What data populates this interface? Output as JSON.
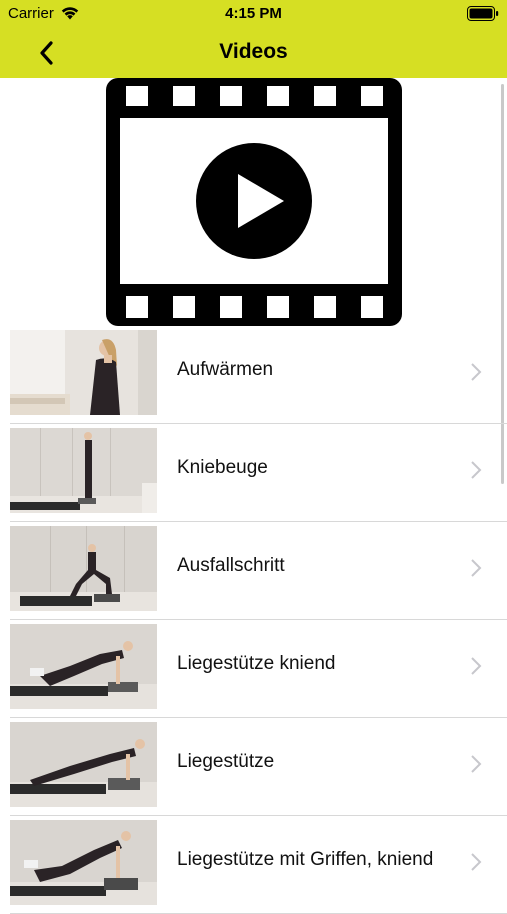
{
  "status": {
    "carrier": "Carrier",
    "time": "4:15 PM"
  },
  "nav": {
    "title": "Videos",
    "back_icon": "chevron-left-icon"
  },
  "colors": {
    "header_bg": "#d6df23",
    "separator": "#d8d8d8",
    "chevron": "#c7c7cc"
  },
  "items": [
    {
      "label": "Aufwärmen",
      "thumb_pose": "standing-side"
    },
    {
      "label": "Kniebeuge",
      "thumb_pose": "standing-plate"
    },
    {
      "label": "Ausfallschritt",
      "thumb_pose": "lunge"
    },
    {
      "label": "Liegestütze kniend",
      "thumb_pose": "kneeling-pushup"
    },
    {
      "label": "Liegestütze",
      "thumb_pose": "pushup"
    },
    {
      "label": "Liegestütze mit Griffen, kniend",
      "thumb_pose": "kneeling-pushup-grips"
    }
  ]
}
